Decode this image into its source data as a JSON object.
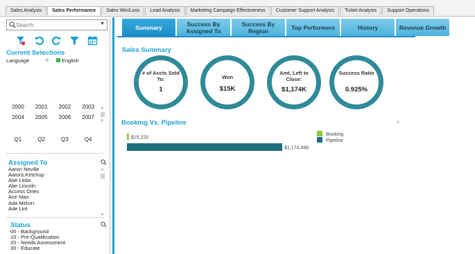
{
  "tabs": [
    "Sales Analysis",
    "Sales Performance",
    "Sales Win/Loss",
    "Lead Analysis",
    "Marketing Campaign Effectiveness",
    "Customer Support Analysis",
    "Ticket Analysis",
    "Support Operations"
  ],
  "active_tab": "Sales Performance",
  "search": {
    "placeholder": "Search"
  },
  "current_selections": {
    "title": "Current Selections",
    "field": "Language",
    "value": "English",
    "colors": {
      "selected": "#39b54a"
    }
  },
  "years": [
    "2000",
    "2001",
    "2002",
    "2003",
    "2004",
    "2005",
    "2006",
    "2007"
  ],
  "quarters": [
    "Q1",
    "Q2",
    "Q3",
    "Q4"
  ],
  "assigned_to": {
    "title": "Assigned To",
    "items": [
      "Aaron Neville",
      "AaronLKetchup",
      "Abe Leda",
      "Abe Lincoln",
      "Access Ories",
      "Ace Man",
      "Ada Melvin",
      "Ade Lint"
    ]
  },
  "status": {
    "title": "Status",
    "items": [
      "00 - Background",
      "10 - Pre-Qualification",
      "20 - Needs Assessment",
      "30 - Educate"
    ]
  },
  "nav_buttons": [
    {
      "label": "Summary",
      "active": true
    },
    {
      "label": "Success By Assigned To",
      "active": false
    },
    {
      "label": "Success By Region",
      "active": false
    },
    {
      "label": "Top Performers",
      "active": false
    },
    {
      "label": "History",
      "active": false
    },
    {
      "label": "Revenue Growth",
      "active": false
    }
  ],
  "sales_summary": {
    "title": "Sales Summary",
    "kpis": [
      {
        "label": "# of Accts Sold To:",
        "value": "1"
      },
      {
        "label": "Won",
        "value": "$15K"
      },
      {
        "label": "Amt. Left to Close:",
        "value": "$1,174K"
      },
      {
        "label": "Success Ratio",
        "value": "0.925%"
      }
    ],
    "colors": {
      "ring": "#2f8a99"
    }
  },
  "booking_chart": {
    "title": "Booking Vs. Pipeline",
    "expand_icon": "expand-icon"
  },
  "chart_data": {
    "type": "bar",
    "orientation": "horizontal",
    "title": "Booking Vs. Pipeline",
    "series": [
      {
        "name": "Booking",
        "value": 15220,
        "label": "$15,220",
        "color": "#8dc63f"
      },
      {
        "name": "Pipeline",
        "value": 1174499,
        "label": "$1,174,499",
        "color": "#1f6f80"
      }
    ],
    "legend": "right"
  }
}
